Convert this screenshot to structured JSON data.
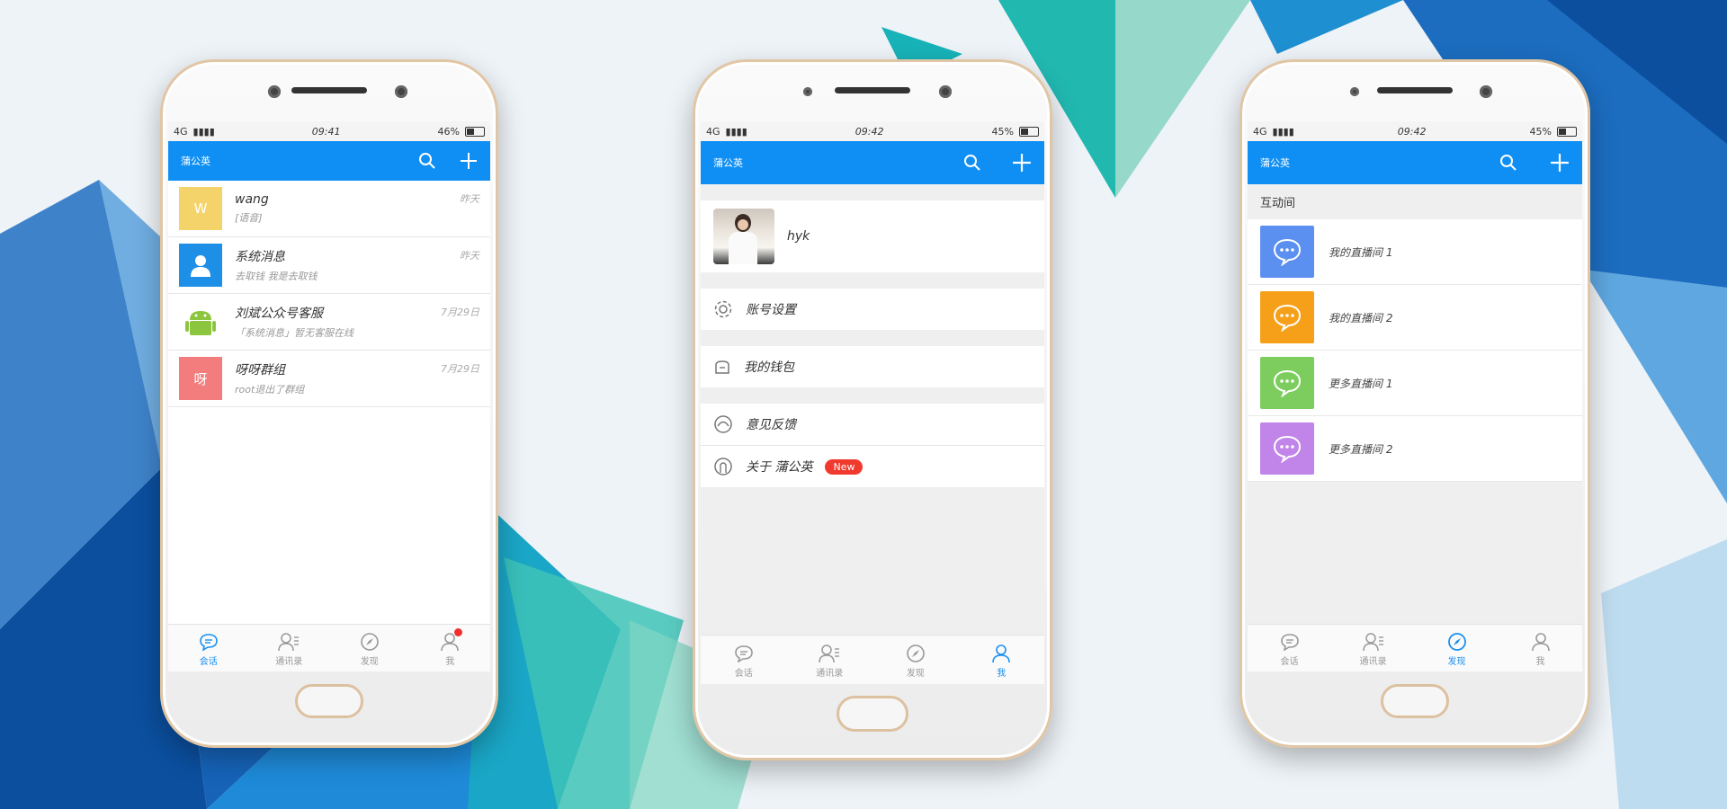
{
  "colors": {
    "primary": "#0f8ff4",
    "accent": "#1a90f0",
    "badge": "#f03a2e"
  },
  "phone1": {
    "status": {
      "network": "4G",
      "time": "09:41",
      "battery": "46%"
    },
    "app_title": "蒲公英",
    "conversations": [
      {
        "avatar_text": "W",
        "avatar_color": "#f4d46a",
        "name": "wang",
        "preview": "[语音]",
        "time": "昨天"
      },
      {
        "avatar_text": "",
        "avatar_color": "#1e8fe6",
        "name": "系统消息",
        "preview": "去取钱 我是去取钱",
        "time": "昨天"
      },
      {
        "avatar_text": "",
        "avatar_color": "#8cc63e",
        "name": "刘斌公众号客服",
        "preview": "「系统消息」暂无客服在线",
        "time": "7月29日"
      },
      {
        "avatar_text": "呀",
        "avatar_color": "#f37c7c",
        "name": "呀呀群组",
        "preview": "root退出了群组",
        "time": "7月29日"
      }
    ],
    "tabs": [
      "会话",
      "通讯录",
      "发现",
      "我"
    ]
  },
  "phone2": {
    "status": {
      "network": "4G",
      "time": "09:42",
      "battery": "45%"
    },
    "app_title": "蒲公英",
    "profile_name": "hyk",
    "menu": {
      "account_settings": "账号设置",
      "wallet": "我的钱包",
      "feedback": "意见反馈",
      "about": "关于 蒲公英",
      "new_badge": "New"
    },
    "tabs": [
      "会话",
      "通讯录",
      "发现",
      "我"
    ]
  },
  "phone3": {
    "status": {
      "network": "4G",
      "time": "09:42",
      "battery": "45%"
    },
    "app_title": "蒲公英",
    "section_title": "互动间",
    "rooms": [
      {
        "label": "我的直播间 1",
        "color": "#5b8ff0"
      },
      {
        "label": "我的直播间 2",
        "color": "#f5a018"
      },
      {
        "label": "更多直播间 1",
        "color": "#7ccd5e"
      },
      {
        "label": "更多直播间 2",
        "color": "#c184e8"
      }
    ],
    "tabs": [
      "会话",
      "通讯录",
      "发现",
      "我"
    ]
  }
}
